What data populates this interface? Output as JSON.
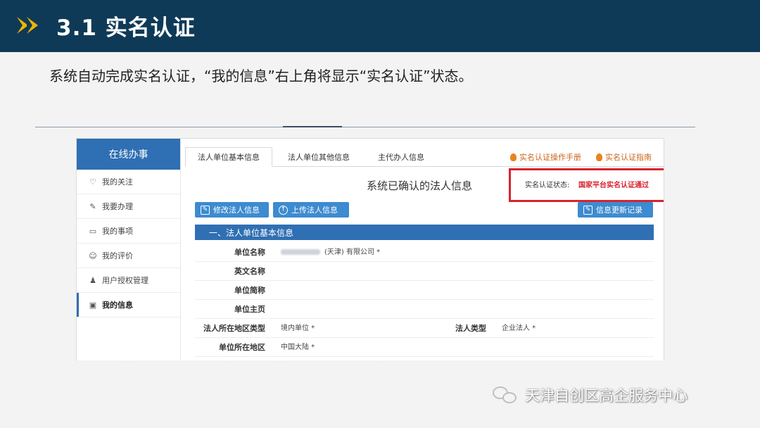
{
  "slide": {
    "title": "3.1 实名认证",
    "subtitle": "系统自动完成实名认证，“我的信息”右上角将显示“实名认证”状态。"
  },
  "sidebar": {
    "header": "在线办事",
    "items": [
      {
        "icon": "heart-icon",
        "glyph": "♡",
        "label": "我的关注"
      },
      {
        "icon": "pen-icon",
        "glyph": "✎",
        "label": "我要办理"
      },
      {
        "icon": "folder-icon",
        "glyph": "▭",
        "label": "我的事项"
      },
      {
        "icon": "smile-icon",
        "glyph": "☺",
        "label": "我的评价"
      },
      {
        "icon": "user-icon",
        "glyph": "♟",
        "label": "用户授权管理"
      },
      {
        "icon": "id-card-icon",
        "glyph": "▣",
        "label": "我的信息"
      }
    ]
  },
  "tabs": [
    "法人单位基本信息",
    "法人单位其他信息",
    "主代办人信息"
  ],
  "help_links": [
    "实名认证操作手册",
    "实名认证指南"
  ],
  "confirm_title": "系统已确认的法人信息",
  "status": {
    "label": "实名认证状态:",
    "value": "国家平台实名认证通过",
    "color": "#d9232e"
  },
  "buttons": {
    "edit": "修改法人信息",
    "upload": "上传法人信息",
    "history": "信息更新记录"
  },
  "section_title": "一、法人单位基本信息",
  "form": {
    "unit_name_label": "单位名称",
    "unit_name_value": "(天津) 有限公司 *",
    "english_name_label": "英文名称",
    "short_name_label": "单位简称",
    "homepage_label": "单位主页",
    "region_type_label": "法人所在地区类型",
    "region_type_value": "境内单位 *",
    "legal_type_label": "法人类型",
    "legal_type_value": "企业法人 *",
    "unit_region_label": "单位所在地区",
    "unit_region_value": "中国大陆 *"
  },
  "watermark": "天津自创区高企服务中心",
  "colors": {
    "header_bg": "#0f3a57",
    "accent_blue": "#2f6fb3",
    "button_blue": "#3d8bd0",
    "chevron": "#f0b400"
  }
}
